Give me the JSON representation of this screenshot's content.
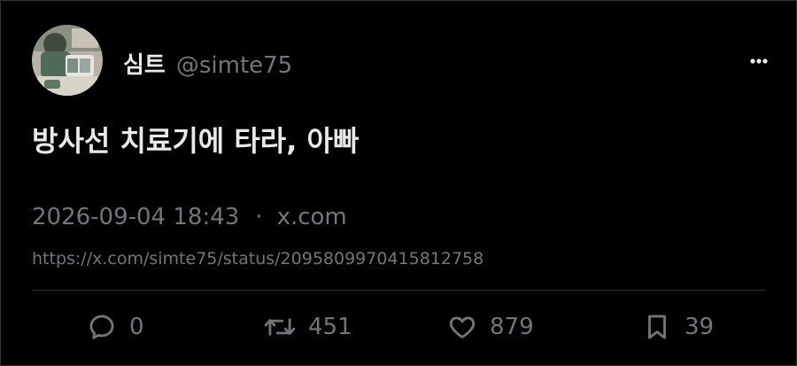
{
  "author": {
    "display_name": "심트",
    "handle": "@simte75"
  },
  "tweet": {
    "text": "방사선 치료기에 타라, 아빠"
  },
  "meta": {
    "datetime": "2026-09-04 18:43",
    "separator": "·",
    "source": "x.com"
  },
  "status_url": "https://x.com/simte75/status/2095809970415812758",
  "actions": {
    "replies": "0",
    "reposts": "451",
    "likes": "879",
    "bookmarks": "39"
  },
  "icons": {
    "more": "more-horizontal-icon",
    "reply": "speech-bubble-icon",
    "repost": "repost-arrows-icon",
    "like": "heart-icon",
    "bookmark": "bookmark-icon"
  },
  "colors": {
    "background": "#000000",
    "primary_text": "#e7e9ea",
    "secondary_text": "#71767b",
    "border": "#2f3336"
  }
}
